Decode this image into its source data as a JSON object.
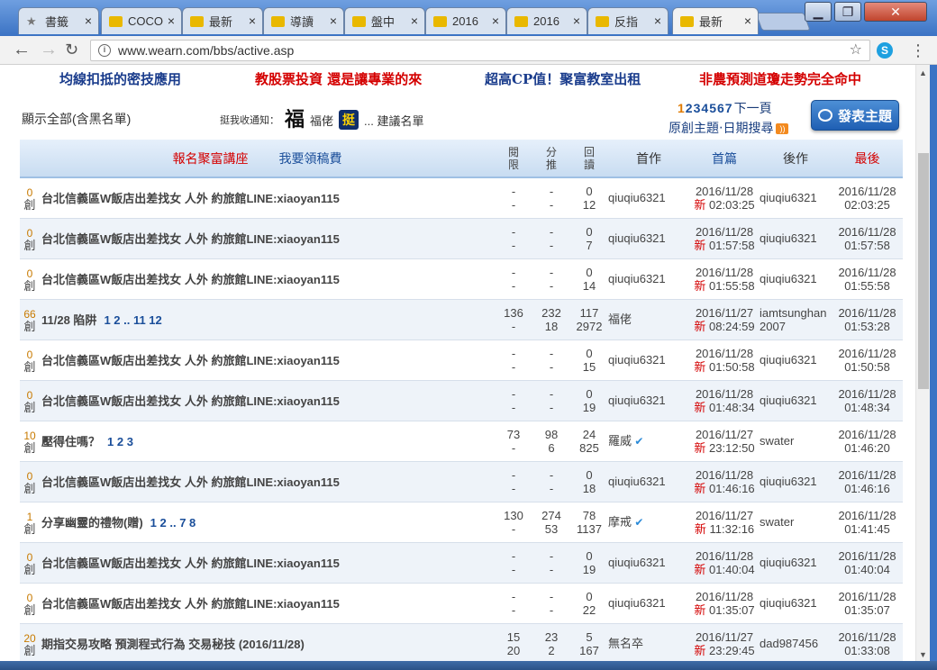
{
  "tabs": [
    {
      "label": "書籤",
      "fav": "#888888",
      "icon": "star-icon"
    },
    {
      "label": "COCO",
      "fav": "#e9b800",
      "icon": "site-icon"
    },
    {
      "label": "最新",
      "fav": "#e9b800",
      "icon": "site-icon"
    },
    {
      "label": "導讀",
      "fav": "#e9b800",
      "icon": "site-icon"
    },
    {
      "label": "盤中",
      "fav": "#e9b800",
      "icon": "site-icon"
    },
    {
      "label": "2016",
      "fav": "#e9b800",
      "icon": "site-icon"
    },
    {
      "label": "2016",
      "fav": "#e9b800",
      "icon": "site-icon"
    },
    {
      "label": "反指",
      "fav": "#e9b800",
      "icon": "site-icon"
    },
    {
      "label": "最新",
      "fav": "#e9b800",
      "icon": "site-icon",
      "active": true
    }
  ],
  "browser": {
    "url": "www.wearn.com/bbs/active.asp",
    "close_glyph": "×"
  },
  "ads": [
    {
      "text": "均線扣抵的密技應用",
      "color": "#1a3c8c"
    },
    {
      "text": "教股票投資 還是讓專業的來",
      "color": "#d40000"
    },
    {
      "text": "超高CP值！聚富教室出租",
      "color": "#1a3c8c"
    },
    {
      "text": "非農預測道瓊走勢完全命中",
      "color": "#d40000"
    }
  ],
  "notice": "顯示全部(含黑名單)",
  "subscribe": {
    "label": "挺我收通知：",
    "fu_glyph": "福",
    "user": "福佬",
    "ting_glyph": "挺",
    "suggest": "... 建議名單"
  },
  "pager": {
    "current": "1",
    "pages": [
      "2",
      "3",
      "4",
      "5",
      "6",
      "7"
    ],
    "next": "下一頁"
  },
  "search_text": "原創主題‧日期搜尋",
  "post_button": "發表主題",
  "header": {
    "register": "報名聚富講座",
    "claim": "我要領稿費",
    "open": "閱\n限",
    "score": "分\n推",
    "reply": "回\n讀",
    "author": "首作",
    "first": "首篇",
    "next_author": "後作",
    "last": "最後"
  },
  "rows": [
    {
      "n": "0",
      "tag": "創",
      "title": "台北信義區W飯店出差找女 人外 約旅館LINE:xiaoyan115",
      "pages": "",
      "a1": "-",
      "a2": "-",
      "b1": "-",
      "b2": "-",
      "c1": "0",
      "c2": "12",
      "author": "qiuqiu6321",
      "verified": false,
      "fd": "2016/11/28",
      "ft": "02:03:25",
      "lastuser": "qiuqiu6321",
      "ld": "2016/11/28",
      "lt": "02:03:25"
    },
    {
      "n": "0",
      "tag": "創",
      "title": "台北信義區W飯店出差找女 人外 約旅館LINE:xiaoyan115",
      "pages": "",
      "a1": "-",
      "a2": "-",
      "b1": "-",
      "b2": "-",
      "c1": "0",
      "c2": "7",
      "author": "qiuqiu6321",
      "verified": false,
      "fd": "2016/11/28",
      "ft": "01:57:58",
      "lastuser": "qiuqiu6321",
      "ld": "2016/11/28",
      "lt": "01:57:58"
    },
    {
      "n": "0",
      "tag": "創",
      "title": "台北信義區W飯店出差找女 人外 約旅館LINE:xiaoyan115",
      "pages": "",
      "a1": "-",
      "a2": "-",
      "b1": "-",
      "b2": "-",
      "c1": "0",
      "c2": "14",
      "author": "qiuqiu6321",
      "verified": false,
      "fd": "2016/11/28",
      "ft": "01:55:58",
      "lastuser": "qiuqiu6321",
      "ld": "2016/11/28",
      "lt": "01:55:58"
    },
    {
      "n": "66",
      "tag": "創",
      "title": "11/28 陷阱",
      "pages": "1 2 .. 11 12",
      "a1": "136",
      "a2": "-",
      "b1": "232",
      "b2": "18",
      "c1": "117",
      "c2": "2972",
      "author": "福佬",
      "verified": false,
      "fd": "2016/11/27",
      "ft": "08:24:59",
      "lastuser": "iamtsunghan2007",
      "ld": "2016/11/28",
      "lt": "01:53:28"
    },
    {
      "n": "0",
      "tag": "創",
      "title": "台北信義區W飯店出差找女 人外 約旅館LINE:xiaoyan115",
      "pages": "",
      "a1": "-",
      "a2": "-",
      "b1": "-",
      "b2": "-",
      "c1": "0",
      "c2": "15",
      "author": "qiuqiu6321",
      "verified": false,
      "fd": "2016/11/28",
      "ft": "01:50:58",
      "lastuser": "qiuqiu6321",
      "ld": "2016/11/28",
      "lt": "01:50:58"
    },
    {
      "n": "0",
      "tag": "創",
      "title": "台北信義區W飯店出差找女 人外 約旅館LINE:xiaoyan115",
      "pages": "",
      "a1": "-",
      "a2": "-",
      "b1": "-",
      "b2": "-",
      "c1": "0",
      "c2": "19",
      "author": "qiuqiu6321",
      "verified": false,
      "fd": "2016/11/28",
      "ft": "01:48:34",
      "lastuser": "qiuqiu6321",
      "ld": "2016/11/28",
      "lt": "01:48:34"
    },
    {
      "n": "10",
      "tag": "創",
      "title": "壓得住嗎？",
      "pages": "1 2 3",
      "a1": "73",
      "a2": "-",
      "b1": "98",
      "b2": "6",
      "c1": "24",
      "c2": "825",
      "author": "羅威",
      "verified": true,
      "fd": "2016/11/27",
      "ft": "23:12:50",
      "lastuser": "swater",
      "ld": "2016/11/28",
      "lt": "01:46:20"
    },
    {
      "n": "0",
      "tag": "創",
      "title": "台北信義區W飯店出差找女 人外 約旅館LINE:xiaoyan115",
      "pages": "",
      "a1": "-",
      "a2": "-",
      "b1": "-",
      "b2": "-",
      "c1": "0",
      "c2": "18",
      "author": "qiuqiu6321",
      "verified": false,
      "fd": "2016/11/28",
      "ft": "01:46:16",
      "lastuser": "qiuqiu6321",
      "ld": "2016/11/28",
      "lt": "01:46:16"
    },
    {
      "n": "1",
      "tag": "創",
      "title": "分享幽靈的禮物(贈)",
      "pages": "1 2 .. 7 8",
      "a1": "130",
      "a2": "-",
      "b1": "274",
      "b2": "53",
      "c1": "78",
      "c2": "1137",
      "author": "摩戒",
      "verified": true,
      "fd": "2016/11/27",
      "ft": "11:32:16",
      "lastuser": "swater",
      "ld": "2016/11/28",
      "lt": "01:41:45"
    },
    {
      "n": "0",
      "tag": "創",
      "title": "台北信義區W飯店出差找女 人外 約旅館LINE:xiaoyan115",
      "pages": "",
      "a1": "-",
      "a2": "-",
      "b1": "-",
      "b2": "-",
      "c1": "0",
      "c2": "19",
      "author": "qiuqiu6321",
      "verified": false,
      "fd": "2016/11/28",
      "ft": "01:40:04",
      "lastuser": "qiuqiu6321",
      "ld": "2016/11/28",
      "lt": "01:40:04"
    },
    {
      "n": "0",
      "tag": "創",
      "title": "台北信義區W飯店出差找女 人外 約旅館LINE:xiaoyan115",
      "pages": "",
      "a1": "-",
      "a2": "-",
      "b1": "-",
      "b2": "-",
      "c1": "0",
      "c2": "22",
      "author": "qiuqiu6321",
      "verified": false,
      "fd": "2016/11/28",
      "ft": "01:35:07",
      "lastuser": "qiuqiu6321",
      "ld": "2016/11/28",
      "lt": "01:35:07"
    },
    {
      "n": "20",
      "tag": "創",
      "title": "期指交易攻略 預測程式行為 交易秘技 (2016/11/28)",
      "pages": "",
      "a1": "15",
      "a2": "20",
      "b1": "23",
      "b2": "2",
      "c1": "5",
      "c2": "167",
      "author": "無名卒",
      "verified": false,
      "fd": "2016/11/27",
      "ft": "23:29:45",
      "lastuser": "dad987456",
      "ld": "2016/11/28",
      "lt": "01:33:08"
    }
  ],
  "new_label": "新"
}
